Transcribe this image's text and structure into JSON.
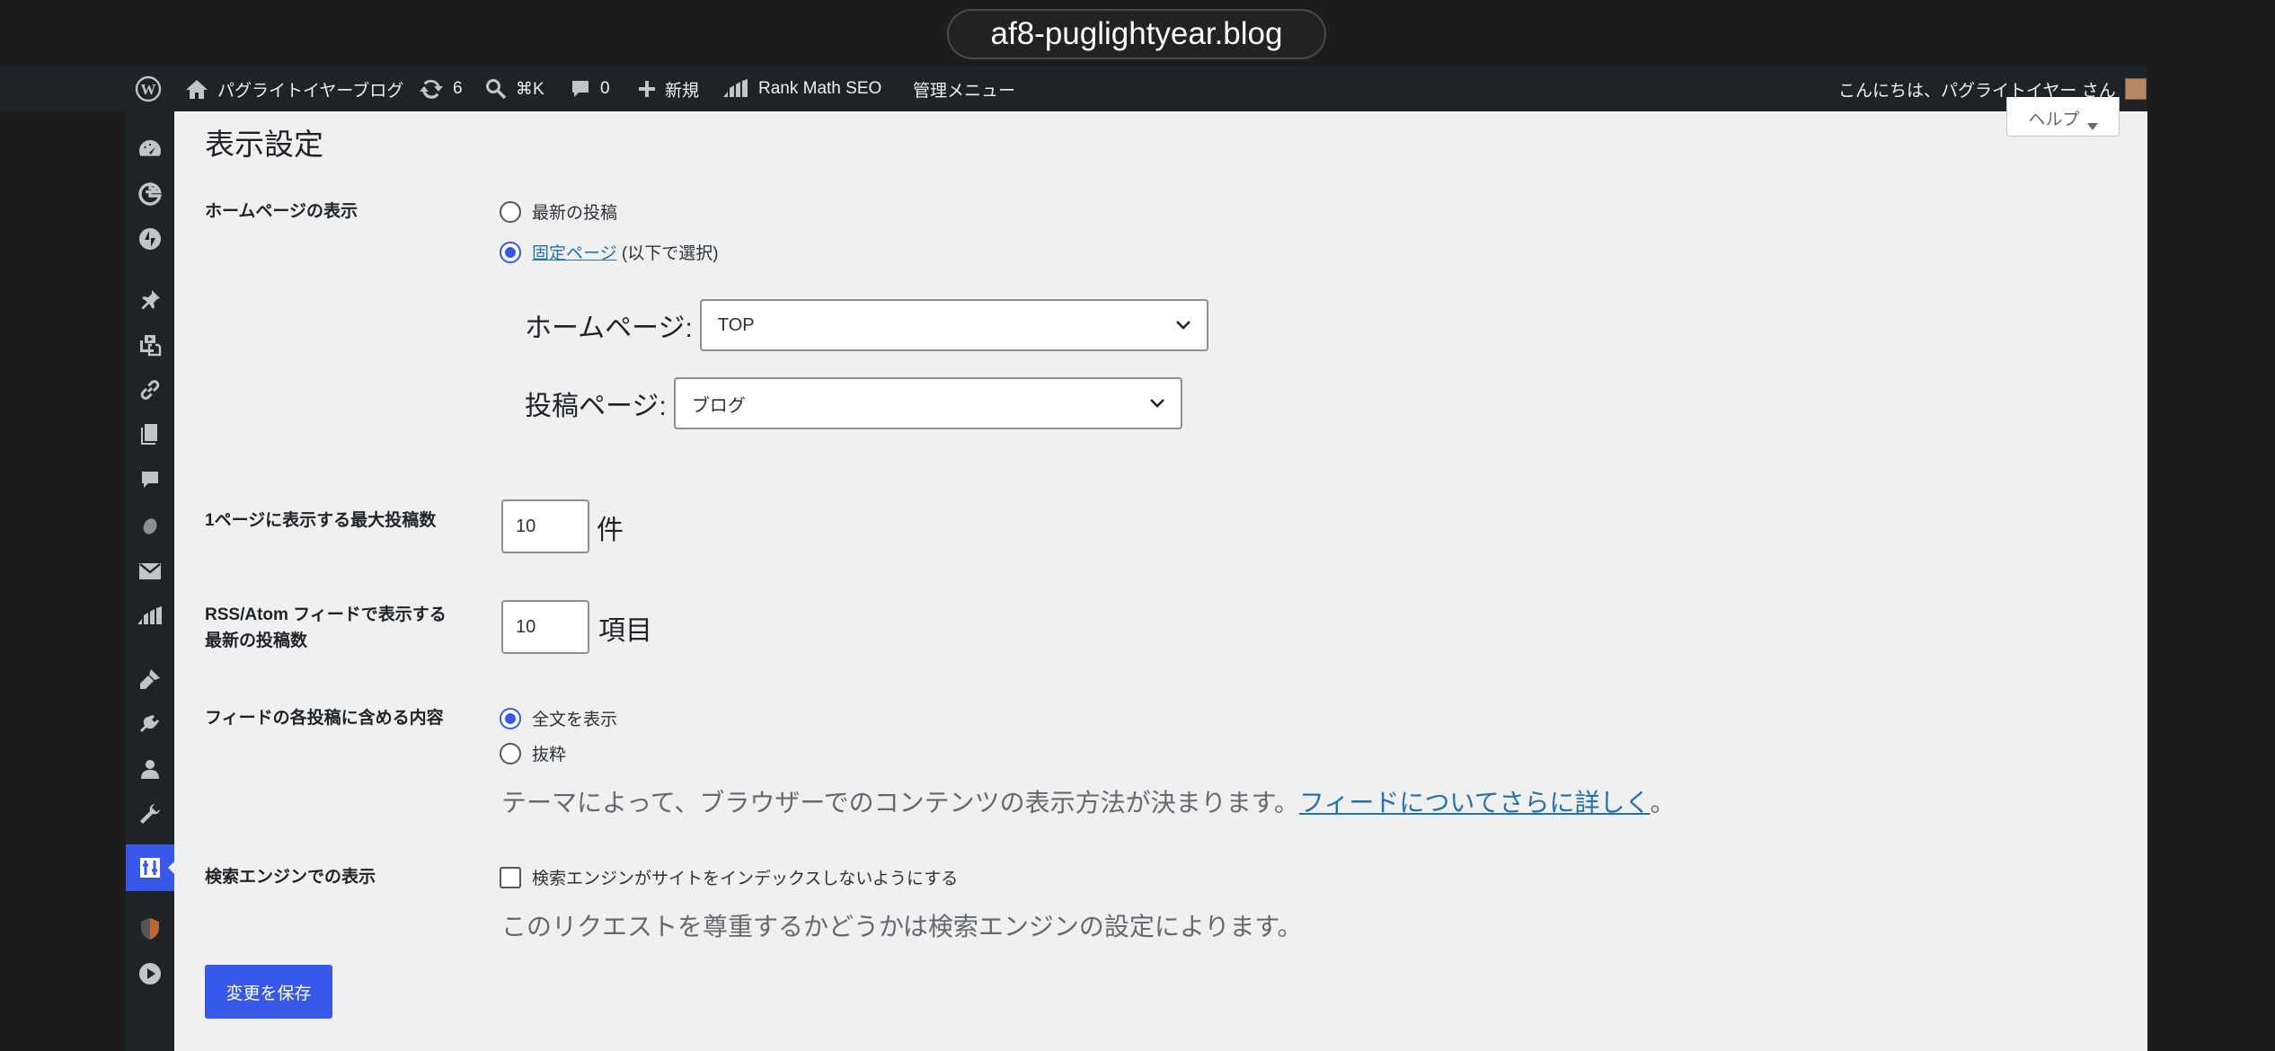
{
  "browser": {
    "url": "af8-puglightyear.blog"
  },
  "adminbar": {
    "site_name": "パグライトイヤーブログ",
    "updates_count": "6",
    "search_shortcut": "⌘K",
    "comments_count": "0",
    "new_label": "新規",
    "rankmath_label": "Rank Math SEO",
    "admin_menu_label": "管理メニュー",
    "greeting": "こんにちは、パグライトイヤー さん"
  },
  "help_tab": {
    "label": "ヘルプ"
  },
  "page": {
    "title": "表示設定",
    "homepage_display": {
      "label": "ホームページの表示",
      "option_latest": "最新の投稿",
      "option_static_link": "固定ページ",
      "option_static_suffix": " (以下で選択)",
      "selected": "static"
    },
    "homepage_select": {
      "label": "ホームページ:",
      "value": "TOP"
    },
    "posts_page_select": {
      "label": "投稿ページ:",
      "value": "ブログ"
    },
    "posts_per_page": {
      "label": "1ページに表示する最大投稿数",
      "value": "10",
      "unit": "件"
    },
    "feed_items": {
      "label_line1": "RSS/Atom フィードで表示する",
      "label_line2": "最新の投稿数",
      "value": "10",
      "unit": "項目"
    },
    "feed_content": {
      "label": "フィードの各投稿に含める内容",
      "option_full": "全文を表示",
      "option_excerpt": "抜粋",
      "selected": "full",
      "desc_text": "テーマによって、ブラウザーでのコンテンツの表示方法が決まります。",
      "desc_link": "フィードについてさらに詳しく",
      "desc_end": "。"
    },
    "search_visibility": {
      "label": "検索エンジンでの表示",
      "checkbox_label": "検索エンジンがサイトをインデックスしないようにする",
      "checked": false,
      "desc": "このリクエストを尊重するかどうかは検索エンジンの設定によります。"
    },
    "save_button": "変更を保存"
  },
  "colors": {
    "accent": "#3858e9",
    "adminbar": "#1d2327",
    "content_bg": "#f0f0f1"
  }
}
